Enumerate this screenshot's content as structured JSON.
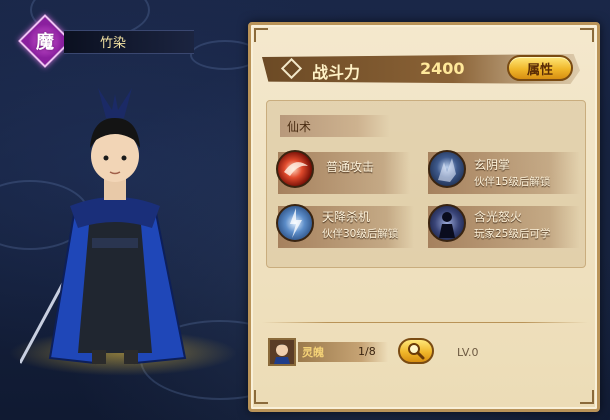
{
  "hero": {
    "faction_char": "魔",
    "name": "竹染"
  },
  "panel": {
    "power_label": "战斗力",
    "power_value": "2400",
    "attributes_button": "属性",
    "skills_section_label": "仙术",
    "skills": [
      {
        "name": "普通攻击",
        "status": "",
        "icon": "red-swirl-attack-icon"
      },
      {
        "name": "玄阴掌",
        "status": "伙伴15级后解锁",
        "icon": "dark-palm-icon"
      },
      {
        "name": "天降杀机",
        "status": "伙伴30级后解锁",
        "icon": "blue-lightning-icon"
      },
      {
        "name": "含光怒火",
        "status": "玩家25级后可学",
        "icon": "shadow-figure-icon"
      }
    ],
    "spirit": {
      "label": "灵魄",
      "count": "1/8"
    },
    "level": "LV.0"
  },
  "colors": {
    "panel_bg": "#f4e8cd",
    "panel_border": "#b99358",
    "gold_button": "#f0b72a",
    "faction_purple": "#b93fc8",
    "background": "#16223f"
  }
}
